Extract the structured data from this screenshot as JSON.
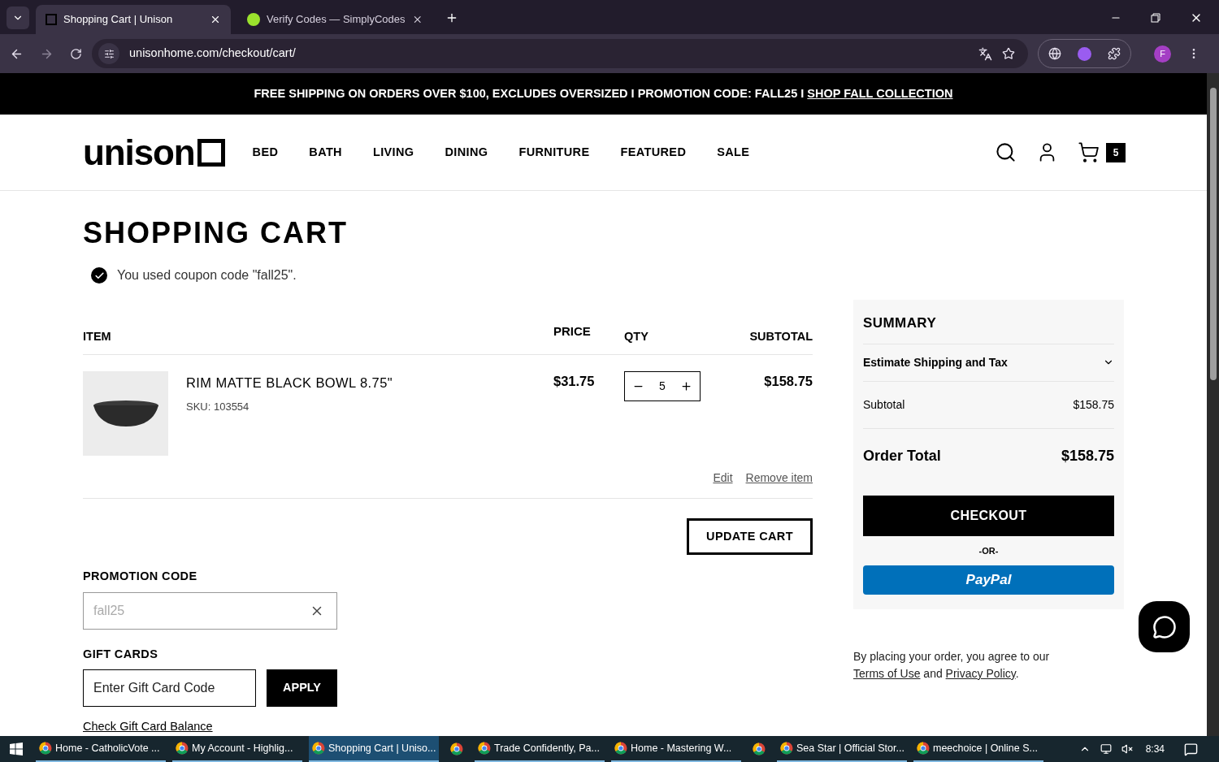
{
  "browser": {
    "tabs": [
      {
        "title": "Shopping Cart | Unison",
        "selected": true
      },
      {
        "title": "Verify Codes — SimplyCodes",
        "selected": false
      }
    ],
    "address": "unisonhome.com/checkout/cart/",
    "profile_initial": "F"
  },
  "promo_bar": {
    "text": "FREE SHIPPING ON ORDERS OVER $100, EXCLUDES OVERSIZED I PROMOTION CODE: FALL25 I ",
    "link": "SHOP FALL COLLECTION"
  },
  "nav": {
    "logo": "unison",
    "items": [
      "BED",
      "BATH",
      "LIVING",
      "DINING",
      "FURNITURE",
      "FEATURED",
      "SALE"
    ],
    "cart_count": "5"
  },
  "page": {
    "title": "SHOPPING CART",
    "notice": "You used coupon code \"fall25\".",
    "columns": [
      "ITEM",
      "PRICE",
      "QTY",
      "SUBTOTAL"
    ],
    "items": [
      {
        "name": "RIM MATTE BLACK BOWL 8.75\"",
        "sku": "SKU: 103554",
        "price": "$31.75",
        "qty": "5",
        "subtotal": "$158.75"
      }
    ],
    "actions": [
      "Edit",
      "Remove item"
    ],
    "update_button": "UPDATE CART",
    "promotion": {
      "label": "PROMOTION CODE",
      "value": "fall25",
      "disabled": true
    },
    "gift_cards": {
      "label": "GIFT CARDS",
      "placeholder": "Enter Gift Card Code",
      "apply": "APPLY",
      "balance_link": "Check Gift Card Balance"
    }
  },
  "summary": {
    "title": "SUMMARY",
    "shipping_label": "Estimate Shipping and Tax",
    "expanded": false,
    "subtotal": {
      "label": "Subtotal",
      "value": "$158.75"
    },
    "total": {
      "label": "Order Total",
      "value": "$158.75"
    },
    "checkout": "CHECKOUT",
    "or": "-OR-",
    "paypal": "PayPal"
  },
  "agreement": {
    "prefix": "By placing your order, you agree to our ",
    "terms": "Terms of Use",
    "middle": " and ",
    "privacy": "Privacy Policy",
    "suffix": "."
  },
  "taskbar": {
    "items": [
      {
        "kind": "app",
        "label": "Home - CatholicVote ...",
        "selected": false
      },
      {
        "kind": "app",
        "label": "My Account - Highlig...",
        "selected": false
      },
      {
        "kind": "app",
        "label": "Shopping Cart | Uniso...",
        "selected": true
      },
      {
        "kind": "icon",
        "selected": false
      },
      {
        "kind": "app",
        "label": "Trade Confidently, Pa...",
        "selected": false
      },
      {
        "kind": "app",
        "label": "Home - Mastering W...",
        "selected": false
      },
      {
        "kind": "icon",
        "selected": false
      },
      {
        "kind": "app",
        "label": "Sea Star | Official Stor...",
        "selected": false
      },
      {
        "kind": "app",
        "label": "meechoice | Online S...",
        "selected": false
      }
    ],
    "clock": "8:34"
  }
}
